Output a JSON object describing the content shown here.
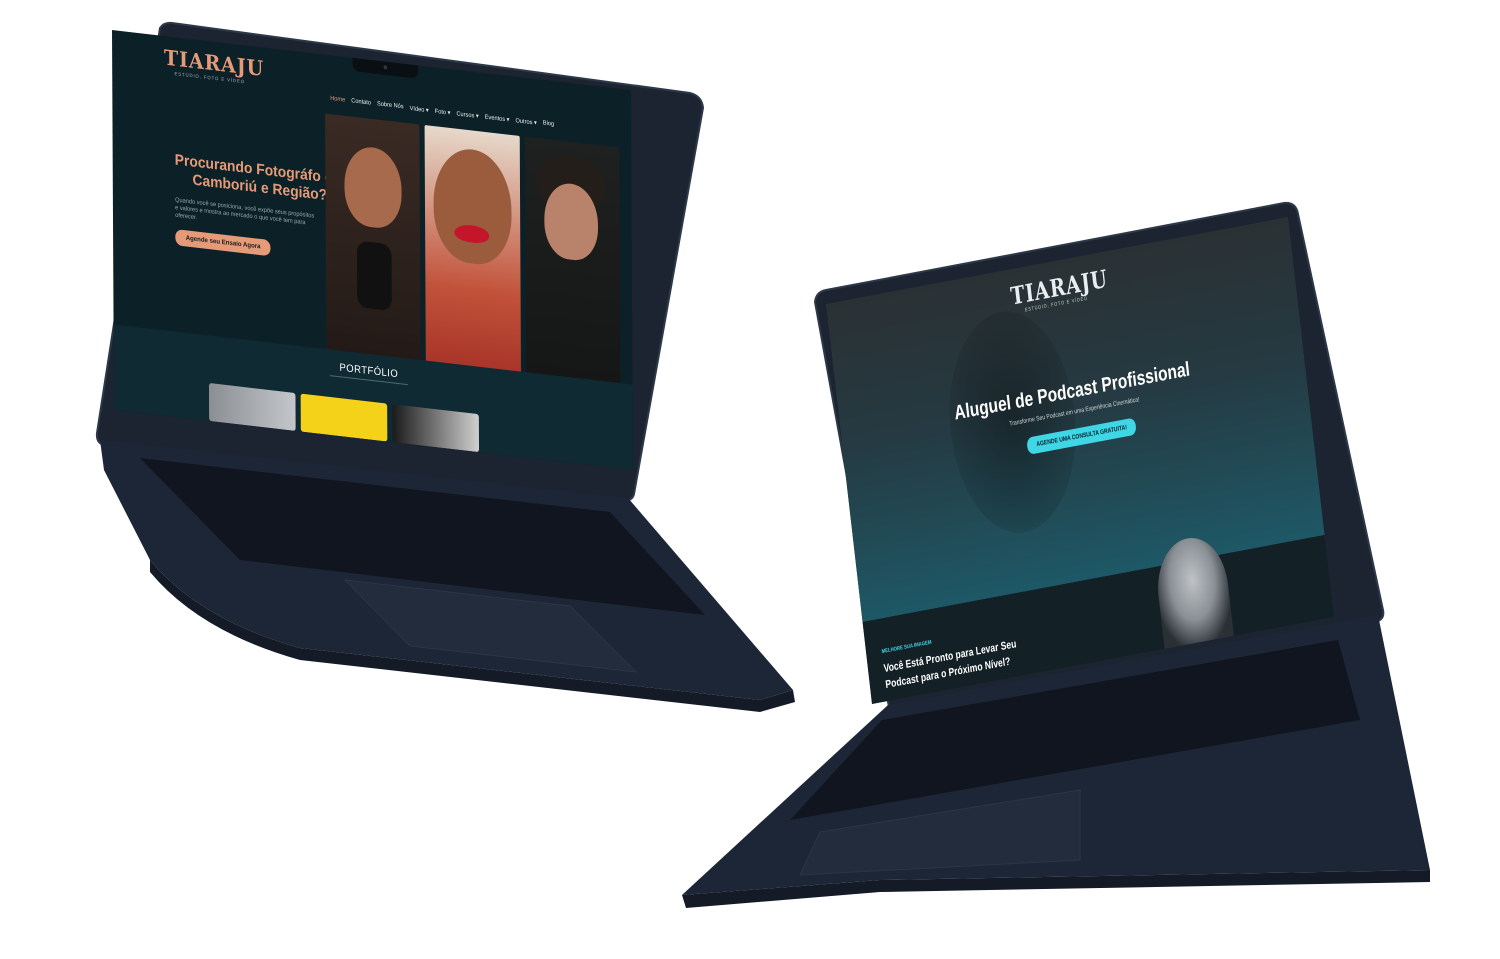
{
  "laptop_left": {
    "logo": "TIARAJU",
    "logo_sub": "ESTÚDIO, FOTO E VÍDEO",
    "nav": [
      {
        "label": "Home",
        "active": true
      },
      {
        "label": "Contato"
      },
      {
        "label": "Sobre Nós"
      },
      {
        "label": "Vídeo ▾"
      },
      {
        "label": "Foto ▾"
      },
      {
        "label": "Cursos ▾"
      },
      {
        "label": "Eventos ▾"
      },
      {
        "label": "Outros ▾"
      },
      {
        "label": "Blog"
      }
    ],
    "hero_title": "Procurando Fotográfo em Camboriú e Região?",
    "hero_text": "Quando você se posiciona, você expõe seus propósitos e valores e mostra ao mercado o que você tem para oferecer.",
    "cta": "Agende seu Ensaio Agora",
    "section_title": "PORTFÓLIO"
  },
  "laptop_right": {
    "logo": "TIARAJU",
    "logo_sub": "ESTÚDIO, FOTO E VÍDEO",
    "hero_title": "Aluguel de Podcast Profissional",
    "hero_sub": "Transforme Seu Podcast em uma Experiência Cinemática!",
    "cta": "AGENDE UMA CONSULTA GRATUITA!",
    "kicker": "MELHORE SUA IMAGEM",
    "section_heading": "Você Está Pronto para Levar Seu Podcast para o Próximo Nível?"
  },
  "colors": {
    "accent_orange": "#e59b78",
    "accent_cyan": "#3fd6e6",
    "laptop_body": "#1e2938"
  }
}
